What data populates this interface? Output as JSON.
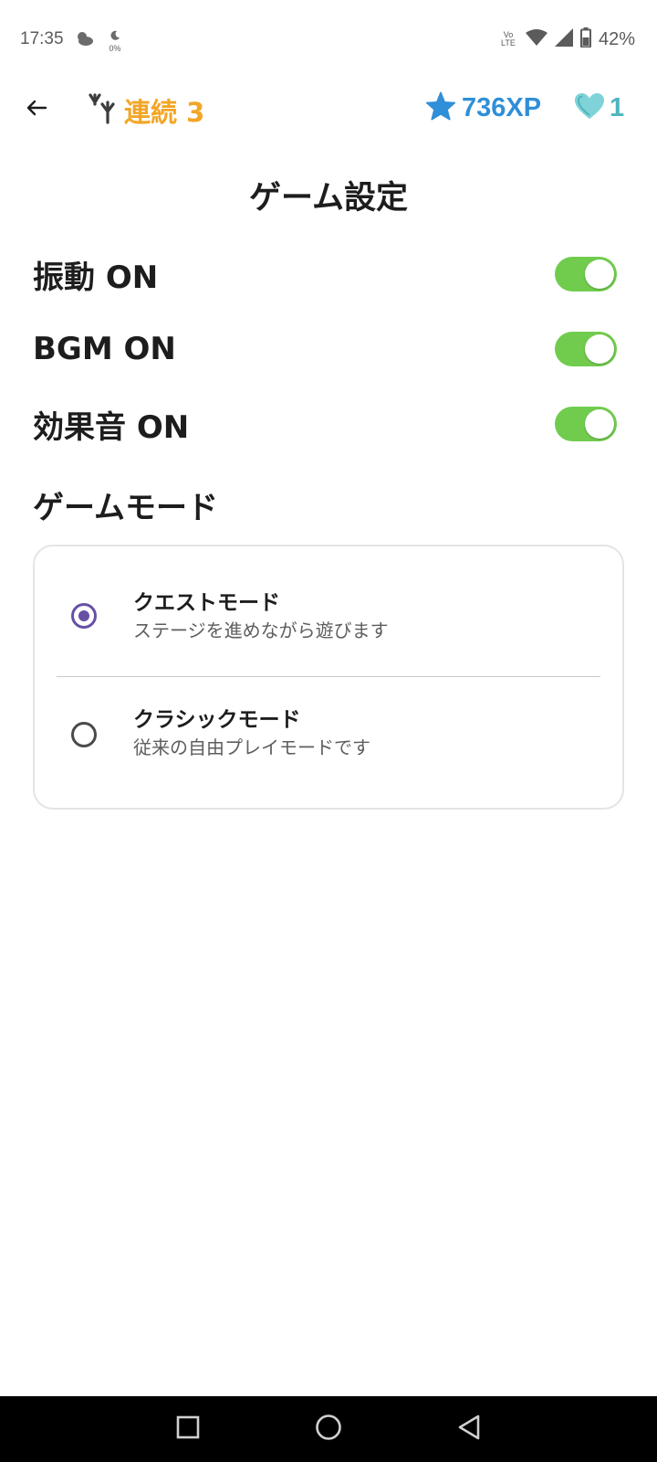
{
  "status_bar": {
    "time": "17:35",
    "data_saver": "0%",
    "network": "Vo LTE",
    "battery": "42%",
    "icons": [
      "cloud-icon",
      "moon-icon",
      "volte-icon",
      "wifi-icon",
      "signal-icon",
      "battery-icon"
    ]
  },
  "top_bar": {
    "back_icon": "arrow-left-icon",
    "streak_label": "連続 3",
    "xp_label": "736XP",
    "hearts_label": "1"
  },
  "page": {
    "title": "ゲーム設定"
  },
  "settings": [
    {
      "label": "振動 ON",
      "enabled": true
    },
    {
      "label": "BGM ON",
      "enabled": true
    },
    {
      "label": "効果音 ON",
      "enabled": true
    }
  ],
  "game_mode": {
    "heading": "ゲームモード",
    "options": [
      {
        "title": "クエストモード",
        "description": "ステージを進めながら遊びます",
        "selected": true
      },
      {
        "title": "クラシックモード",
        "description": "従来の自由プレイモードです",
        "selected": false
      }
    ]
  },
  "colors": {
    "streak": "#f2a626",
    "xp": "#2f8fd8",
    "hearts": "#4db5bd",
    "toggle_on": "#71cc4e",
    "radio_selected": "#6750a4"
  }
}
